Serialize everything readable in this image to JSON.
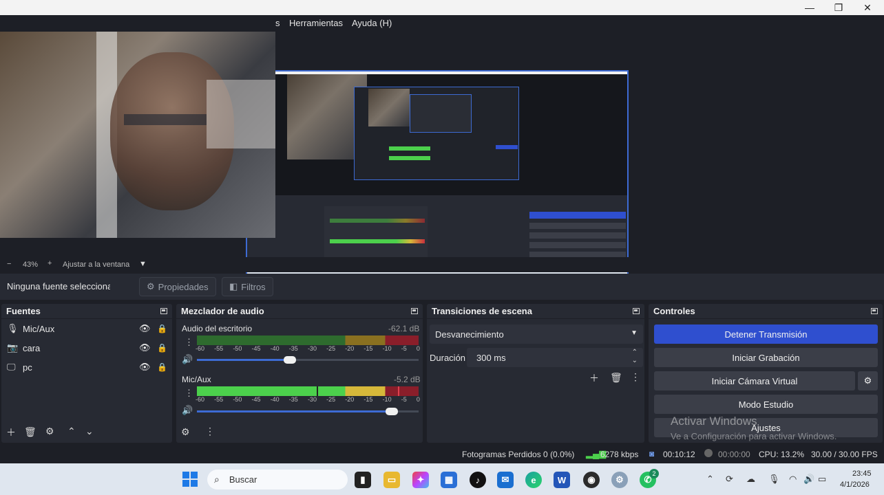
{
  "window": {
    "minimize": "—",
    "maximize": "❐",
    "close": "✕"
  },
  "menu": {
    "partial": "s",
    "tools": "Herramientas",
    "help": "Ayuda (H)"
  },
  "zoom": {
    "minus": "−",
    "value": "43%",
    "plus": "+",
    "fit": "Ajustar a la ventana",
    "arrow": "▼"
  },
  "source_toolbar": {
    "selected": "Ninguna fuente seleccionada",
    "properties": "Propiedades",
    "filters": "Filtros"
  },
  "sources": {
    "title": "Fuentes",
    "items": [
      {
        "label": "Mic/Aux",
        "icon": "microphone-icon"
      },
      {
        "label": "cara",
        "icon": "camera-icon"
      },
      {
        "label": "pc",
        "icon": "monitor-icon"
      }
    ]
  },
  "mixer": {
    "title": "Mezclador de audio",
    "channels": [
      {
        "name": "Audio del escritorio",
        "db": "-62.1 dB",
        "level": 0.0,
        "volume": 0.42
      },
      {
        "name": "Mic/Aux",
        "db": "-5.2 dB",
        "level": 0.93,
        "volume": 0.88
      }
    ],
    "ticks": [
      "-60",
      "-55",
      "-50",
      "-45",
      "-40",
      "-35",
      "-30",
      "-25",
      "-20",
      "-15",
      "-10",
      "-5",
      "0"
    ]
  },
  "transitions": {
    "title": "Transiciones de escena",
    "selected": "Desvanecimiento",
    "duration_label": "Duración",
    "duration_value": "300 ms"
  },
  "controls": {
    "title": "Controles",
    "stop_stream": "Detener Transmisión",
    "start_recording": "Iniciar Grabación",
    "virtual_cam": "Iniciar Cámara Virtual",
    "studio_mode": "Modo Estudio",
    "settings": "Ajustes"
  },
  "watermark": {
    "line1": "Activar Windows",
    "line2": "Ve a Configuración para activar Windows."
  },
  "status": {
    "dropped": "Fotogramas Perdidos 0 (0.0%)",
    "bitrate": "6278 kbps",
    "stream_time": "00:10:12",
    "rec_time": "00:00:00",
    "cpu": "CPU: 13.2%",
    "fps": "30.00 / 30.00 FPS"
  },
  "taskbar": {
    "search": "Buscar",
    "time": "23:45",
    "date": "4/1/2026",
    "whatsapp_badge": "2"
  },
  "colors": {
    "accent": "#2f4fcf",
    "meter_green": "#4cd04c",
    "meter_yellow": "#d6b83a",
    "meter_red": "#c8303c"
  }
}
